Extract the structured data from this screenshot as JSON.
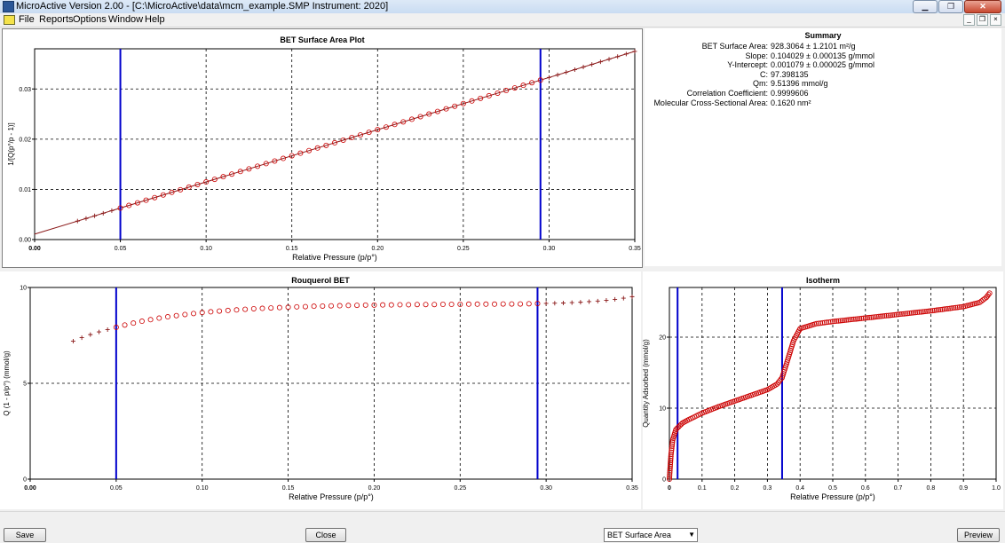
{
  "window": {
    "title": "MicroActive Version 2.00 - [C:\\MicroActive\\data\\mcm_example.SMP Instrument: 2020]",
    "controls": [
      "▁",
      "❐",
      "✕"
    ],
    "mdi_controls": [
      "_",
      "❐",
      "×"
    ]
  },
  "menu": [
    "File",
    "Reports",
    "Options",
    "Window",
    "Help"
  ],
  "summary": {
    "title": "Summary",
    "rows": [
      {
        "label": "BET Surface Area:",
        "value": "928.3064 ± 1.2101 m²/g"
      },
      {
        "label": "Slope:",
        "value": "0.104029 ± 0.000135 g/mmol"
      },
      {
        "label": "Y-Intercept:",
        "value": "0.001079 ± 0.000025 g/mmol"
      },
      {
        "label": "C:",
        "value": "97.398135"
      },
      {
        "label": "Qm:",
        "value": "9.51396 mmol/g"
      },
      {
        "label": "Correlation Coefficient:",
        "value": "0.9999606"
      },
      {
        "label": "Molecular Cross-Sectional Area:",
        "value": "0.1620 nm²"
      }
    ]
  },
  "buttons": {
    "save": "Save",
    "close": "Close",
    "preview": "Preview"
  },
  "report_select": {
    "value": "BET Surface Area",
    "arrow": "▼"
  },
  "colors": {
    "axis_blue": "#0000cc",
    "marker_red": "#cc0000",
    "fit_line": "#8b1a1a"
  },
  "chart_data": [
    {
      "id": "bet",
      "type": "scatter",
      "title": "BET Surface Area Plot",
      "xlabel": "Relative Pressure (p/p°)",
      "ylabel": "1/[Q(p°/p - 1)]",
      "xlim": [
        0,
        0.35
      ],
      "ylim": [
        0,
        0.038
      ],
      "xticks": [
        "0.00",
        "0.05",
        "0.10",
        "0.15",
        "0.20",
        "0.25",
        "0.30",
        "0.35"
      ],
      "yticks": [
        {
          "v": 0,
          "label": "0.00"
        },
        {
          "v": 0.01,
          "label": "0.01"
        },
        {
          "v": 0.02,
          "label": "0.02"
        },
        {
          "v": 0.03,
          "label": "0.03"
        }
      ],
      "grid": true,
      "selection_lines": [
        0.05,
        0.295
      ],
      "fit": {
        "slope": 0.104029,
        "intercept": 0.001079
      },
      "selected_range": [
        0.05,
        0.295
      ],
      "x_start": 0.025,
      "x_end": 0.35,
      "n_points": 66
    },
    {
      "id": "rouquerol",
      "type": "scatter",
      "title": "Rouquerol BET",
      "xlabel": "Relative Pressure (p/p°)",
      "ylabel": "Q (1 - p/p°) (mmol/g)",
      "xlim": [
        0,
        0.35
      ],
      "ylim": [
        0,
        10
      ],
      "xticks": [
        "0.00",
        "0.05",
        "0.10",
        "0.15",
        "0.20",
        "0.25",
        "0.30",
        "0.35"
      ],
      "yticks": [
        {
          "v": 0,
          "label": "0"
        },
        {
          "v": 5,
          "label": "5"
        },
        {
          "v": 10,
          "label": "10"
        }
      ],
      "grid": true,
      "selection_lines": [
        0.05,
        0.295
      ],
      "x": [
        0.025,
        0.03,
        0.035,
        0.04,
        0.045,
        0.05,
        0.055,
        0.06,
        0.065,
        0.07,
        0.075,
        0.08,
        0.085,
        0.09,
        0.095,
        0.1,
        0.105,
        0.11,
        0.115,
        0.12,
        0.125,
        0.13,
        0.135,
        0.14,
        0.145,
        0.15,
        0.155,
        0.16,
        0.165,
        0.17,
        0.175,
        0.18,
        0.185,
        0.19,
        0.195,
        0.2,
        0.205,
        0.21,
        0.215,
        0.22,
        0.225,
        0.23,
        0.235,
        0.24,
        0.245,
        0.25,
        0.255,
        0.26,
        0.265,
        0.27,
        0.275,
        0.28,
        0.285,
        0.29,
        0.295,
        0.3,
        0.305,
        0.31,
        0.315,
        0.32,
        0.325,
        0.33,
        0.335,
        0.34,
        0.345,
        0.35
      ],
      "y": [
        7.2,
        7.38,
        7.54,
        7.68,
        7.8,
        7.92,
        8.04,
        8.14,
        8.24,
        8.32,
        8.4,
        8.47,
        8.53,
        8.59,
        8.64,
        8.69,
        8.73,
        8.77,
        8.8,
        8.83,
        8.86,
        8.89,
        8.91,
        8.93,
        8.95,
        8.97,
        8.99,
        9.0,
        9.02,
        9.03,
        9.04,
        9.05,
        9.06,
        9.07,
        9.08,
        9.08,
        9.09,
        9.09,
        9.1,
        9.1,
        9.11,
        9.11,
        9.11,
        9.12,
        9.12,
        9.12,
        9.13,
        9.13,
        9.13,
        9.13,
        9.14,
        9.14,
        9.14,
        9.15,
        9.16,
        9.17,
        9.18,
        9.19,
        9.21,
        9.23,
        9.26,
        9.29,
        9.33,
        9.38,
        9.44,
        9.52
      ],
      "selected_range": [
        0.05,
        0.295
      ]
    },
    {
      "id": "isotherm",
      "type": "scatter",
      "title": "Isotherm",
      "xlabel": "Relative Pressure (p/p°)",
      "ylabel": "Quantity Adsorbed (mmol/g)",
      "xlim": [
        0,
        1.0
      ],
      "ylim": [
        0,
        27
      ],
      "xticks": [
        "0",
        "0.1",
        "0.2",
        "0.3",
        "0.4",
        "0.5",
        "0.6",
        "0.7",
        "0.8",
        "0.9",
        "1.0"
      ],
      "yticks": [
        {
          "v": 0,
          "label": "0"
        },
        {
          "v": 10,
          "label": "10"
        },
        {
          "v": 20,
          "label": "20"
        }
      ],
      "grid": true,
      "selection_lines": [
        0.025,
        0.345
      ],
      "curve": [
        [
          0.0,
          0
        ],
        [
          0.002,
          1.5
        ],
        [
          0.005,
          3.5
        ],
        [
          0.01,
          5.5
        ],
        [
          0.02,
          7.0
        ],
        [
          0.04,
          7.9
        ],
        [
          0.06,
          8.4
        ],
        [
          0.1,
          9.3
        ],
        [
          0.15,
          10.2
        ],
        [
          0.2,
          11.0
        ],
        [
          0.25,
          11.8
        ],
        [
          0.3,
          12.6
        ],
        [
          0.33,
          13.4
        ],
        [
          0.345,
          14.3
        ],
        [
          0.36,
          16.5
        ],
        [
          0.38,
          19.5
        ],
        [
          0.4,
          21.2
        ],
        [
          0.45,
          21.9
        ],
        [
          0.5,
          22.2
        ],
        [
          0.6,
          22.7
        ],
        [
          0.7,
          23.2
        ],
        [
          0.8,
          23.7
        ],
        [
          0.9,
          24.3
        ],
        [
          0.95,
          24.9
        ],
        [
          0.97,
          25.6
        ],
        [
          0.98,
          26.2
        ]
      ]
    }
  ]
}
